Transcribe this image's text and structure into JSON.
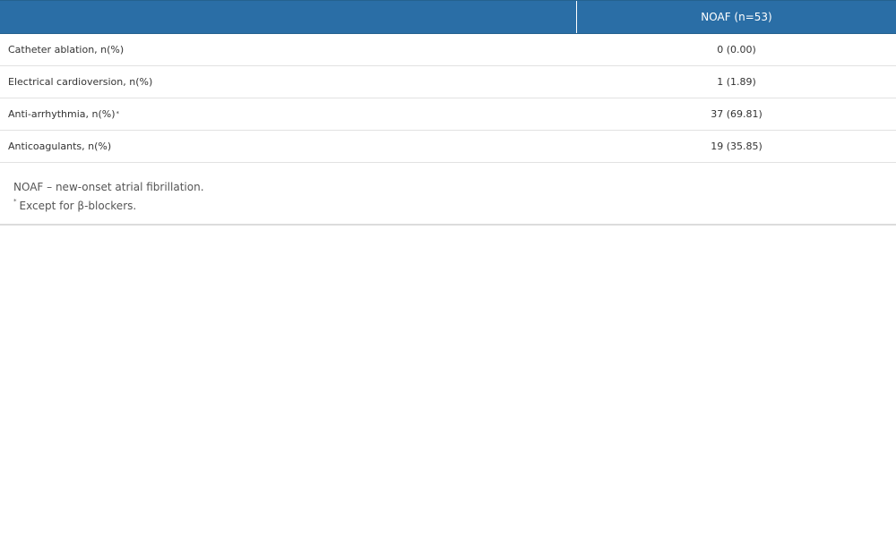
{
  "table": {
    "header": {
      "label": "",
      "value": "NOAF (n=53)"
    },
    "rows": [
      {
        "label": "Catheter ablation, n(%)",
        "marker": "",
        "value": "0 (0.00)"
      },
      {
        "label": "Electrical cardioversion, n(%)",
        "marker": "",
        "value": "1 (1.89)"
      },
      {
        "label": "Anti-arrhythmia, n(%)",
        "marker": "*",
        "value": "37 (69.81)"
      },
      {
        "label": "Anticoagulants, n(%)",
        "marker": "",
        "value": "19 (35.85)"
      }
    ],
    "footnotes": {
      "abbreviation": "NOAF – new-onset atrial fibrillation.",
      "asterisk_marker": "*",
      "asterisk_text": "Except for β-blockers."
    }
  },
  "colors": {
    "header_background": "#2a6ea6",
    "header_text": "#ffffff",
    "row_divider": "#e2e2e2",
    "body_text": "#333333"
  }
}
